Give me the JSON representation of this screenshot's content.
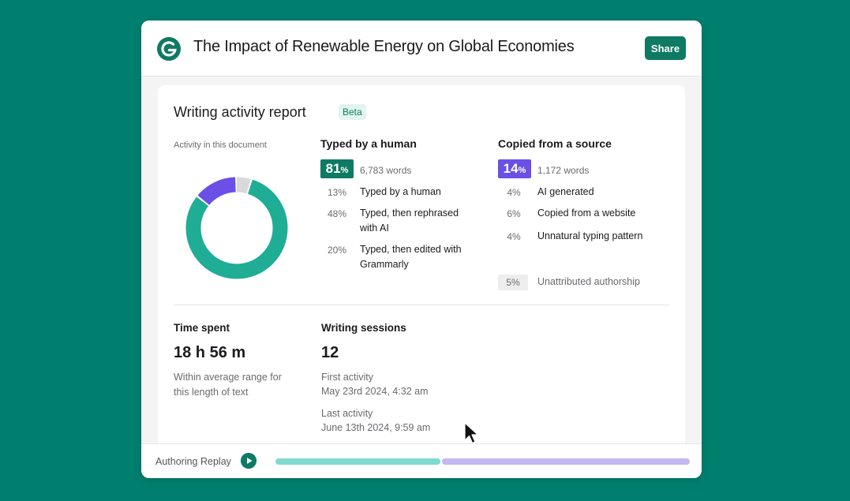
{
  "document": {
    "title": "The Impact of Renewable Energy on Global Economies",
    "share_label": "Share"
  },
  "report": {
    "title": "Writing activity report",
    "badge": "Beta",
    "chart_label": "Activity in this document",
    "donut": {
      "human_pct": 81,
      "copied_pct": 14,
      "unattributed_pct": 5
    },
    "typed": {
      "heading": "Typed by a human",
      "pct": "81",
      "words": "6,783 words",
      "rows": [
        {
          "pct": "13%",
          "text": "Typed by a human"
        },
        {
          "pct": "48%",
          "text": "Typed, then rephrased with AI"
        },
        {
          "pct": "20%",
          "text": "Typed, then edited with Grammarly"
        }
      ]
    },
    "copied": {
      "heading": "Copied from a source",
      "pct": "14",
      "words": "1,172 words",
      "rows": [
        {
          "pct": "4%",
          "text": "AI generated"
        },
        {
          "pct": "6%",
          "text": "Copied from a website"
        },
        {
          "pct": "4%",
          "text": "Unnatural typing pattern"
        }
      ]
    },
    "unattributed": {
      "pct": "5%",
      "text": "Unattributed authorship"
    }
  },
  "time": {
    "heading": "Time spent",
    "value": "18 h 56 m",
    "note": "Within average range for this length of text"
  },
  "sessions": {
    "heading": "Writing sessions",
    "value": "12",
    "first_label": "First activity",
    "first_value": "May 23rd 2024, 4:32 am",
    "last_label": "Last activity",
    "last_value": "June 13th 2024, 9:59 am"
  },
  "replay": {
    "label": "Authoring Replay",
    "human_fraction": 0.4
  },
  "colors": {
    "brand": "#0e7a63",
    "background": "#007f6e",
    "human": "#1fad96",
    "copied": "#6b4fe6",
    "unattributed": "#d9d9dc",
    "replay_human": "#7fdbcf",
    "replay_copied": "#c4b8f0"
  },
  "icons": {
    "logo": "grammarly-logo-icon",
    "play": "play-icon",
    "cursor": "mouse-pointer-icon"
  }
}
